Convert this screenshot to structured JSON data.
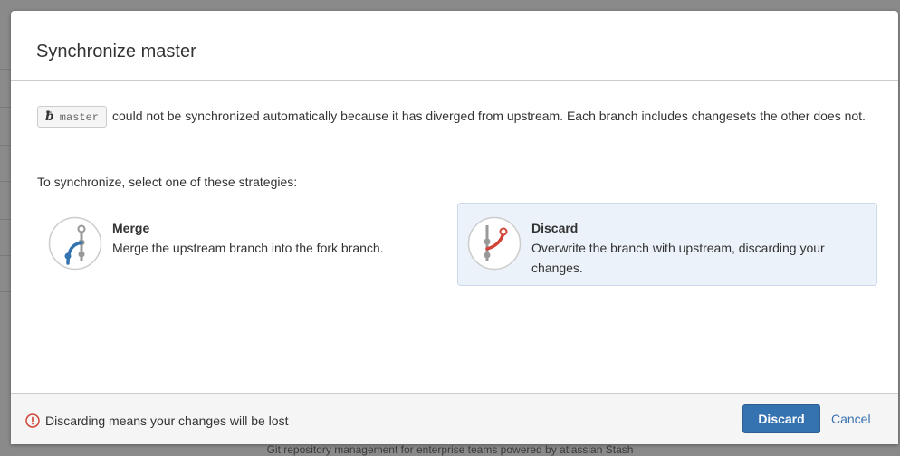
{
  "dialog": {
    "title": "Synchronize master"
  },
  "intro": {
    "branch_name": "master",
    "message": "could not be synchronized automatically because it has diverged from upstream. Each branch includes changesets the other does not."
  },
  "strategy_prompt": "To synchronize, select one of these strategies:",
  "strategies": [
    {
      "name": "Merge",
      "description": "Merge the upstream branch into the fork branch.",
      "icon": "merge-branch-icon",
      "selected": false
    },
    {
      "name": "Discard",
      "description": "Overwrite the branch with upstream, discarding your changes.",
      "icon": "discard-branch-icon",
      "selected": true
    }
  ],
  "footer": {
    "warning": "Discarding means your changes will be lost",
    "primary_button": "Discard",
    "cancel_link": "Cancel"
  },
  "background_text": "Git repository management for enterprise teams powered by atlassian Stash",
  "colors": {
    "primary": "#3572b0",
    "link": "#3b73af",
    "warning": "#d04437",
    "selected_bg": "#ebf2f9",
    "merge_line": "#3572b0",
    "discard_line": "#d04437"
  }
}
